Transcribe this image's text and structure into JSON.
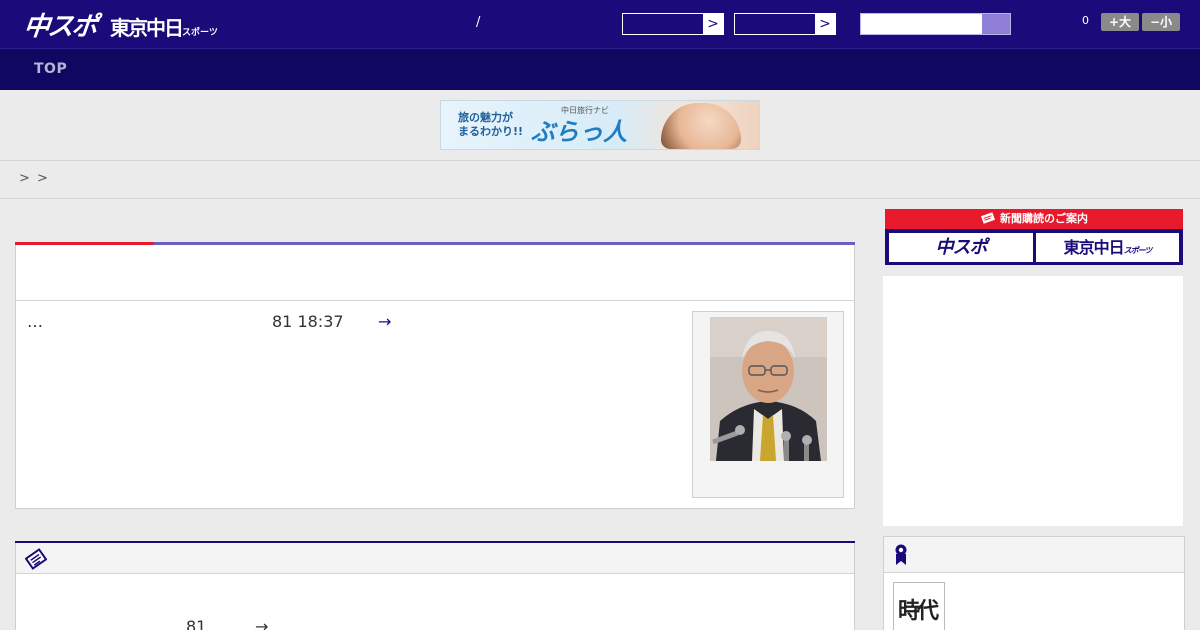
{
  "header": {
    "logo_primary": "中スポ",
    "logo_secondary": "東京中日",
    "logo_secondary_sub": "スポーツ",
    "separator": "/",
    "select_1_arrow": ">",
    "select_2_arrow": ">",
    "search_placeholder": "",
    "counter": "0",
    "font_increase_label": "+大",
    "font_decrease_label": "−小"
  },
  "nav": {
    "items": [
      {
        "label": "TOP"
      }
    ]
  },
  "banner": {
    "headline_line1": "旅の魅力が",
    "headline_line2": "まるわかり!!",
    "sub": "中日旅行ナビ",
    "brand": "ぶらっ人"
  },
  "breadcrumb": {
    "separators": [
      ">",
      ">"
    ]
  },
  "article": {
    "excerpt": "…",
    "date": "81 18:37",
    "more": "→",
    "photo": "portrait-photo"
  },
  "article2": {
    "excerpt": "…",
    "number": "81",
    "more": "→"
  },
  "sidebar": {
    "subscribe_heading": "新聞購読のご案内",
    "subscribe_chuspo": "中スポ",
    "subscribe_tokyo": "東京中日",
    "subscribe_tokyo_sub": "スポーツ",
    "ranking_thumb_text": "時代"
  },
  "colors": {
    "brand_navy": "#190c7a",
    "nav_navy": "#100760",
    "accent_red": "#e8192c",
    "accent_purple": "#6a5fc0",
    "search_button": "#8f7fd9"
  },
  "icons": {
    "newspaper": "newspaper-icon",
    "ribbon": "ribbon-icon",
    "newspaper_small": "newspaper-small-icon"
  }
}
